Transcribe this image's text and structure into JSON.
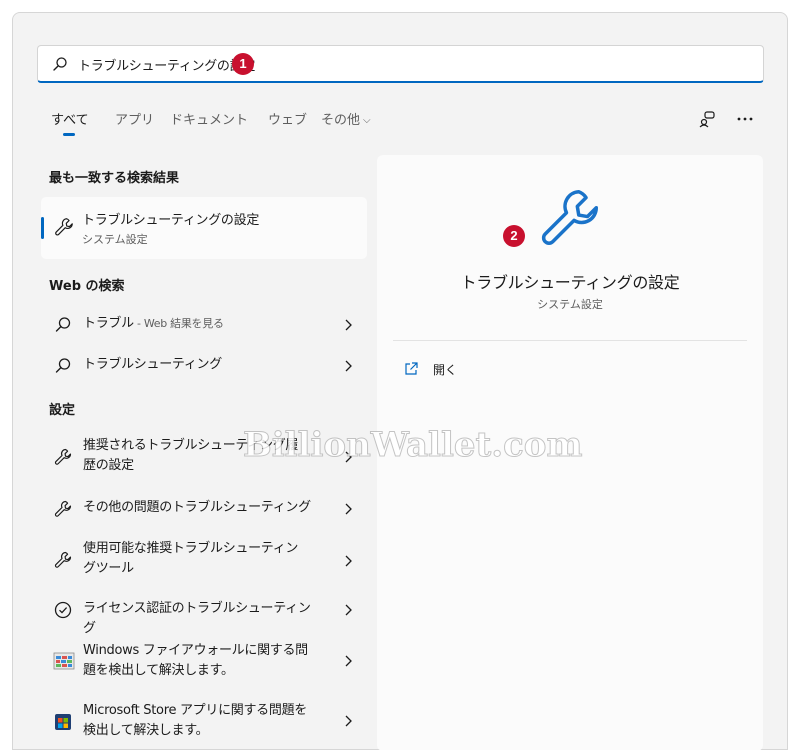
{
  "search": {
    "value": "トラブルシューティングの設定",
    "badge": "1"
  },
  "tabs": [
    {
      "label": "すべて"
    },
    {
      "label": "アプリ"
    },
    {
      "label": "ドキュメント"
    },
    {
      "label": "ウェブ"
    },
    {
      "label": "その他"
    }
  ],
  "best_match": {
    "section_title": "最も一致する検索結果",
    "title": "トラブルシューティングの設定",
    "subtitle": "システム設定"
  },
  "web": {
    "section_title": "Web の検索",
    "items": [
      {
        "label": "トラブル",
        "suffix": " - Web 結果を見る"
      },
      {
        "label": "トラブルシューティング",
        "suffix": ""
      }
    ]
  },
  "settings": {
    "section_title": "設定",
    "items": [
      {
        "label": "推奨されるトラブルシューティング履歴の設定",
        "icon": "wrench-icon"
      },
      {
        "label": "その他の問題のトラブルシューティング",
        "icon": "wrench-icon"
      },
      {
        "label": "使用可能な推奨トラブルシューティングツール",
        "icon": "wrench-icon"
      },
      {
        "label": "ライセンス認証のトラブルシューティング",
        "icon": "check-circle-icon"
      },
      {
        "label": "Windows ファイアウォールに関する問題を検出して解決します。",
        "icon": "firewall-icon"
      },
      {
        "label": "Microsoft Store アプリに関する問題を検出して解決します。",
        "icon": "store-icon"
      }
    ]
  },
  "preview": {
    "title": "トラブルシューティングの設定",
    "subtitle": "システム設定",
    "badge": "2",
    "open_label": "開く"
  },
  "watermark": "BillionWallet.com",
  "colors": {
    "accent": "#0067c0",
    "badge": "#c8102e",
    "icon_blue": "#1a73c9"
  }
}
